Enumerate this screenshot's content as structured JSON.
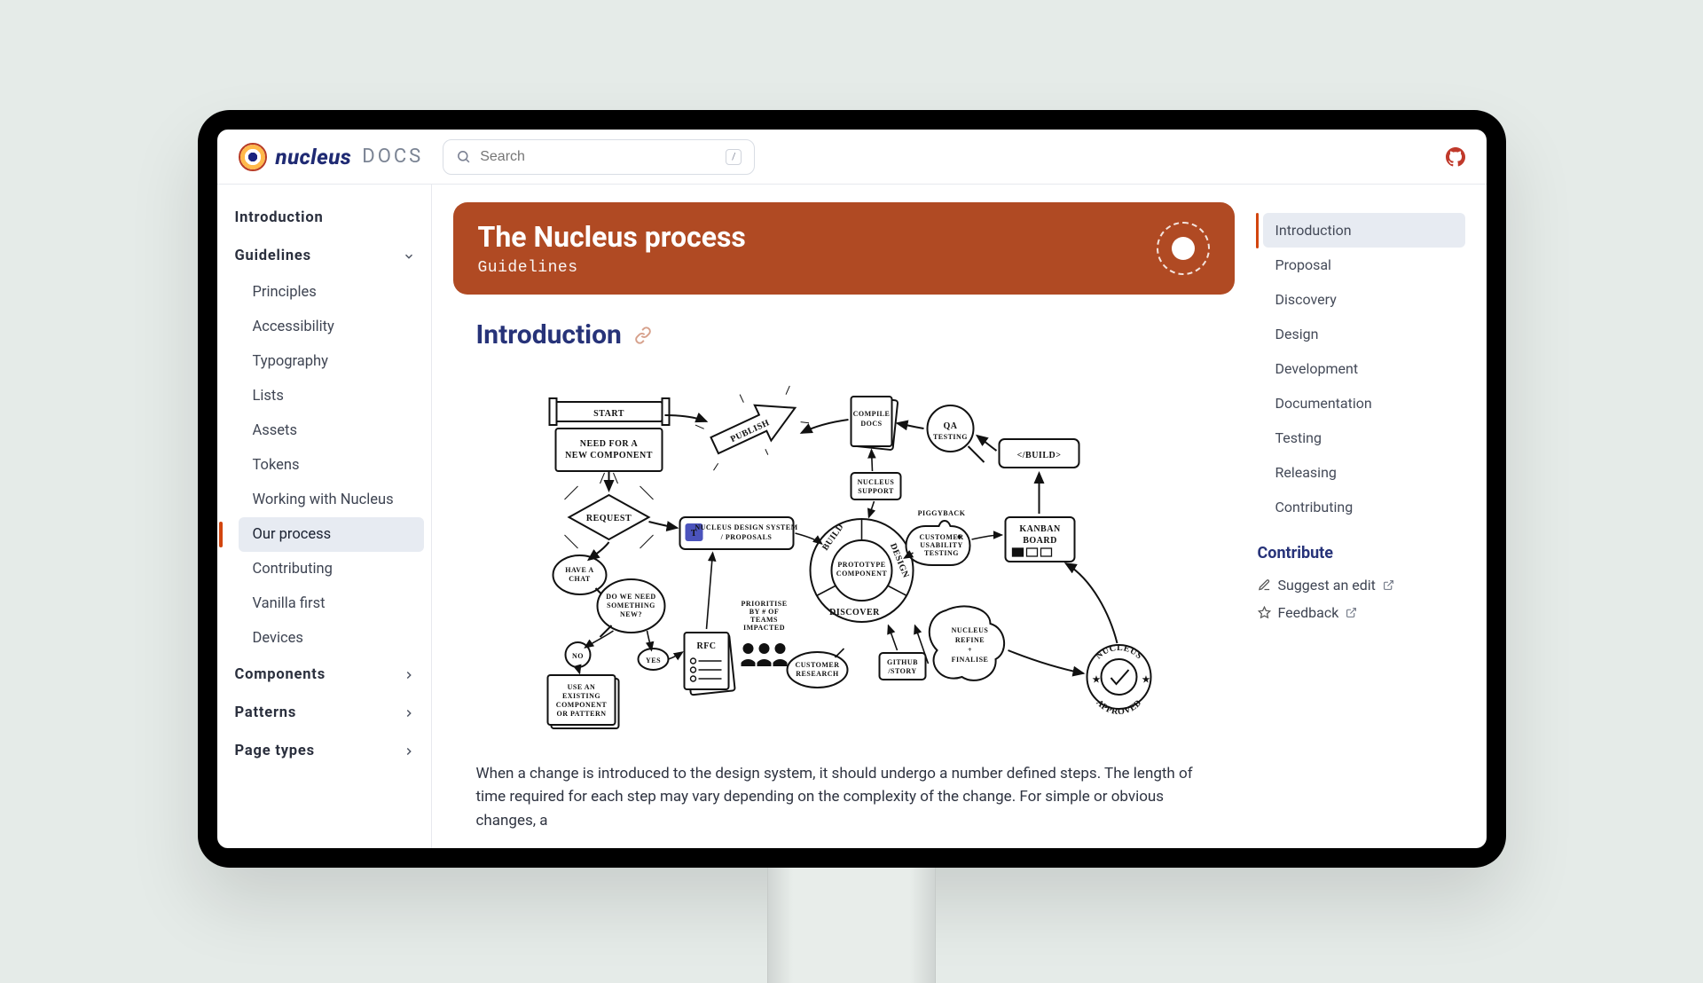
{
  "brand": {
    "word": "nucleus",
    "sub": "DOCS"
  },
  "search": {
    "placeholder": "Search",
    "shortcut": "/"
  },
  "sidebar": {
    "sections": [
      {
        "label": "Introduction",
        "expandable": false
      },
      {
        "label": "Guidelines",
        "expandable": true,
        "expanded": true
      },
      {
        "label": "Components",
        "expandable": true,
        "expanded": false
      },
      {
        "label": "Patterns",
        "expandable": true,
        "expanded": false
      },
      {
        "label": "Page types",
        "expandable": true,
        "expanded": false
      }
    ],
    "guidelines_items": [
      {
        "label": "Principles"
      },
      {
        "label": "Accessibility"
      },
      {
        "label": "Typography"
      },
      {
        "label": "Lists"
      },
      {
        "label": "Assets"
      },
      {
        "label": "Tokens"
      },
      {
        "label": "Working with Nucleus"
      },
      {
        "label": "Our process",
        "active": true
      },
      {
        "label": "Contributing"
      },
      {
        "label": "Vanilla first"
      },
      {
        "label": "Devices"
      }
    ]
  },
  "hero": {
    "title": "The Nucleus process",
    "category": "Guidelines"
  },
  "h2": "Introduction",
  "paragraph": "When a change is introduced to the design system, it should undergo a number defined steps. The length of time required for each step may vary depending on the complexity of the change. For simple or obvious changes, a",
  "toc": {
    "items": [
      {
        "label": "Introduction",
        "active": true
      },
      {
        "label": "Proposal"
      },
      {
        "label": "Discovery"
      },
      {
        "label": "Design"
      },
      {
        "label": "Development"
      },
      {
        "label": "Documentation"
      },
      {
        "label": "Testing"
      },
      {
        "label": "Releasing"
      },
      {
        "label": "Contributing"
      }
    ],
    "contribute_heading": "Contribute",
    "links": [
      {
        "label": "Suggest an edit"
      },
      {
        "label": "Feedback"
      }
    ]
  },
  "diagram": {
    "start_banner": "START",
    "need_box": "NEED FOR A\nNEW COMPONENT",
    "request": "REQUEST",
    "have_a_chat": "HAVE A\nCHAT",
    "do_we_need": "DO WE NEED\nSOMETHING\nNEW?",
    "no": "NO",
    "yes": "YES",
    "use_existing": "USE AN\nEXISTING\nCOMPONENT\nOR PATTERN",
    "rfc": "RFC",
    "teams_label": "NUCLEUS DESIGN SYSTEM\n/ PROPOSALS",
    "prioritise": "PRIORITISE\nBY # OF\nTEAMS\nIMPACTED",
    "publish": "PUBLISH",
    "compile_docs": "COMPILE\nDOCS",
    "nucleus_support": "NUCLEUS\nSUPPORT",
    "wheel_build": "BUILD",
    "wheel_design": "DESIGN",
    "wheel_discover": "DISCOVER",
    "wheel_center": "PROTOTYPE\nCOMPONENT",
    "customer_research": "CUSTOMER\nRESEARCH",
    "github_story": "GITHUB\n/STORY",
    "qa": "QA",
    "qa_sub": "TESTING",
    "build_tag": "</BUILD>",
    "pig_label": "PIGGYBACK",
    "pig_sub": "CUSTOMER\nUSABILITY\nTESTING",
    "kanban": "KANBAN\nBOARD",
    "refine": "NUCLEUS\nREFINE\n+\nFINALISE",
    "approved": "NUCLEUS\nAPPROVED"
  }
}
